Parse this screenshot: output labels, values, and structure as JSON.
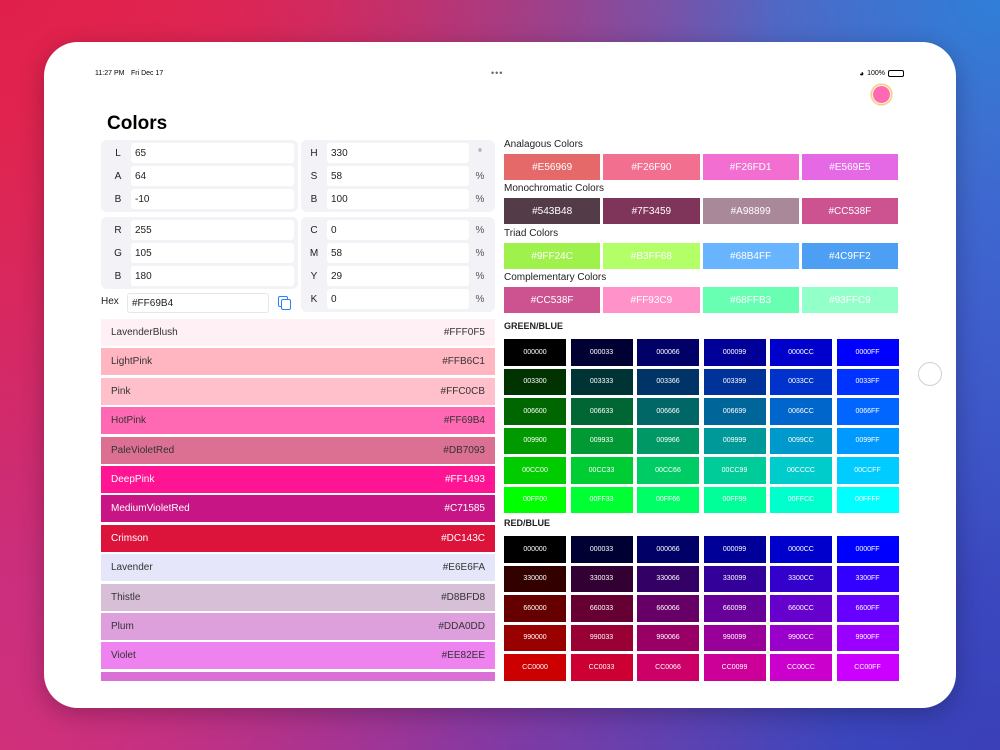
{
  "status_bar": {
    "time": "11:27 PM",
    "date": "Fri Dec 17",
    "battery": "100%",
    "multitask_dots": "•••"
  },
  "title": "Colors",
  "lab": [
    {
      "label": "L",
      "value": "65"
    },
    {
      "label": "A",
      "value": "64"
    },
    {
      "label": "B",
      "value": "-10"
    }
  ],
  "hsb": [
    {
      "label": "H",
      "value": "330",
      "unit": "°"
    },
    {
      "label": "S",
      "value": "58",
      "unit": "%"
    },
    {
      "label": "B",
      "value": "100",
      "unit": "%"
    }
  ],
  "rgb": [
    {
      "label": "R",
      "value": "255"
    },
    {
      "label": "G",
      "value": "105"
    },
    {
      "label": "B",
      "value": "180"
    }
  ],
  "cmyk": [
    {
      "label": "C",
      "value": "0",
      "unit": "%"
    },
    {
      "label": "M",
      "value": "58",
      "unit": "%"
    },
    {
      "label": "Y",
      "value": "29",
      "unit": "%"
    },
    {
      "label": "K",
      "value": "0",
      "unit": "%"
    }
  ],
  "hex": {
    "label": "Hex",
    "value": "#FF69B4"
  },
  "named_colors": [
    {
      "name": "LavenderBlush",
      "hex": "#FFF0F5",
      "text": "#333333"
    },
    {
      "name": "LightPink",
      "hex": "#FFB6C1",
      "text": "#333333"
    },
    {
      "name": "Pink",
      "hex": "#FFC0CB",
      "text": "#333333"
    },
    {
      "name": "HotPink",
      "hex": "#FF69B4",
      "text": "#333333"
    },
    {
      "name": "PaleVioletRed",
      "hex": "#DB7093",
      "text": "#333333"
    },
    {
      "name": "DeepPink",
      "hex": "#FF1493",
      "text": "#ffffff"
    },
    {
      "name": "MediumVioletRed",
      "hex": "#C71585",
      "text": "#ffffff"
    },
    {
      "name": "Crimson",
      "hex": "#DC143C",
      "text": "#ffffff"
    },
    {
      "name": "Lavender",
      "hex": "#E6E6FA",
      "text": "#333333"
    },
    {
      "name": "Thistle",
      "hex": "#D8BFD8",
      "text": "#333333"
    },
    {
      "name": "Plum",
      "hex": "#DDA0DD",
      "text": "#333333"
    },
    {
      "name": "Violet",
      "hex": "#EE82EE",
      "text": "#333333"
    },
    {
      "name": "",
      "hex": "",
      "swatch": "#DA70D6",
      "text": "#333333"
    }
  ],
  "harmonies": [
    {
      "label": "Analagous Colors",
      "colors": [
        "#E56969",
        "#F26F90",
        "#F26FD1",
        "#E569E5"
      ]
    },
    {
      "label": "Monochromatic Colors",
      "colors": [
        "#543B48",
        "#7F3459",
        "#A98899",
        "#CC538F"
      ]
    },
    {
      "label": "Triad Colors",
      "colors": [
        "#9FF24C",
        "#B3FF68",
        "#68B4FF",
        "#4C9FF2"
      ]
    },
    {
      "label": "Complementary Colors",
      "colors": [
        "#CC538F",
        "#FF93C9",
        "#68FFB3",
        "#93FFC9"
      ]
    }
  ],
  "green_blue": {
    "heading": "GREEN/BLUE",
    "rows": [
      [
        "000000",
        "000033",
        "000066",
        "000099",
        "0000CC",
        "0000FF"
      ],
      [
        "003300",
        "003333",
        "003366",
        "003399",
        "0033CC",
        "0033FF"
      ],
      [
        "006600",
        "006633",
        "006666",
        "006699",
        "0066CC",
        "0066FF"
      ],
      [
        "009900",
        "009933",
        "009966",
        "009999",
        "0099CC",
        "0099FF"
      ],
      [
        "00CC00",
        "00CC33",
        "00CC66",
        "00CC99",
        "00CCCC",
        "00CCFF"
      ],
      [
        "00FF00",
        "00FF33",
        "00FF66",
        "00FF99",
        "00FFCC",
        "00FFFF"
      ]
    ]
  },
  "red_blue": {
    "heading": "RED/BLUE",
    "rows": [
      [
        "000000",
        "000033",
        "000066",
        "000099",
        "0000CC",
        "0000FF"
      ],
      [
        "330000",
        "330033",
        "330066",
        "330099",
        "3300CC",
        "3300FF"
      ],
      [
        "660000",
        "660033",
        "660066",
        "660099",
        "6600CC",
        "6600FF"
      ],
      [
        "990000",
        "990033",
        "990066",
        "990099",
        "9900CC",
        "9900FF"
      ],
      [
        "CC0000",
        "CC0033",
        "CC0066",
        "CC0099",
        "CC00CC",
        "CC00FF"
      ]
    ]
  }
}
